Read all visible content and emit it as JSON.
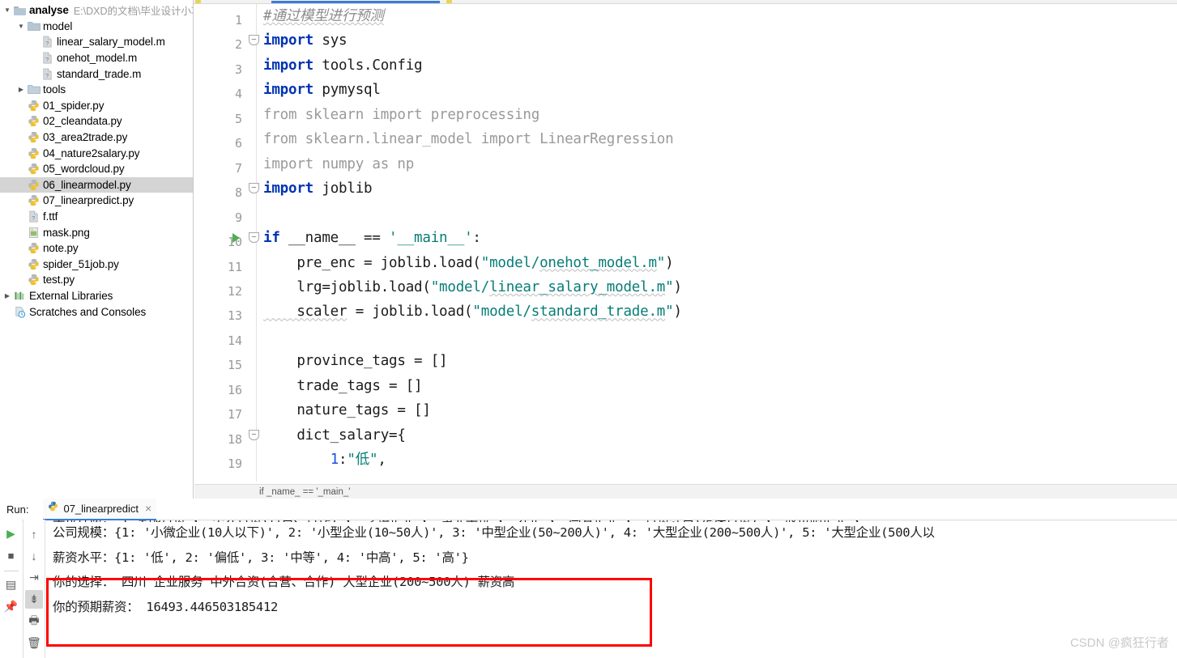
{
  "sidebar": {
    "project": {
      "name": "analyse",
      "path": "E:\\DXD的文档\\毕业设计小项目",
      "twisty": "▼"
    },
    "items": [
      {
        "label": "model",
        "icon": "folder-open-icon",
        "type": "folder",
        "depth": 1,
        "twisty": "▼",
        "selected": false
      },
      {
        "label": "linear_salary_model.m",
        "icon": "unknown-file-icon",
        "type": "file",
        "depth": 2,
        "twisty": "",
        "selected": false
      },
      {
        "label": "onehot_model.m",
        "icon": "unknown-file-icon",
        "type": "file",
        "depth": 2,
        "twisty": "",
        "selected": false
      },
      {
        "label": "standard_trade.m",
        "icon": "unknown-file-icon",
        "type": "file",
        "depth": 2,
        "twisty": "",
        "selected": false
      },
      {
        "label": "tools",
        "icon": "folder-closed-icon",
        "type": "folder",
        "depth": 1,
        "twisty": "▶",
        "selected": false
      },
      {
        "label": "01_spider.py",
        "icon": "python-file-icon",
        "type": "file",
        "depth": 1,
        "twisty": "",
        "selected": false
      },
      {
        "label": "02_cleandata.py",
        "icon": "python-file-icon",
        "type": "file",
        "depth": 1,
        "twisty": "",
        "selected": false
      },
      {
        "label": "03_area2trade.py",
        "icon": "python-file-icon",
        "type": "file",
        "depth": 1,
        "twisty": "",
        "selected": false
      },
      {
        "label": "04_nature2salary.py",
        "icon": "python-file-icon",
        "type": "file",
        "depth": 1,
        "twisty": "",
        "selected": false
      },
      {
        "label": "05_wordcloud.py",
        "icon": "python-file-icon",
        "type": "file",
        "depth": 1,
        "twisty": "",
        "selected": false
      },
      {
        "label": "06_linearmodel.py",
        "icon": "python-file-icon",
        "type": "file",
        "depth": 1,
        "twisty": "",
        "selected": true
      },
      {
        "label": "07_linearpredict.py",
        "icon": "python-file-icon",
        "type": "file",
        "depth": 1,
        "twisty": "",
        "selected": false
      },
      {
        "label": "f.ttf",
        "icon": "unknown-file-icon",
        "type": "file",
        "depth": 1,
        "twisty": "",
        "selected": false
      },
      {
        "label": "mask.png",
        "icon": "image-file-icon",
        "type": "file",
        "depth": 1,
        "twisty": "",
        "selected": false
      },
      {
        "label": "note.py",
        "icon": "python-file-icon",
        "type": "file",
        "depth": 1,
        "twisty": "",
        "selected": false
      },
      {
        "label": "spider_51job.py",
        "icon": "python-file-icon",
        "type": "file",
        "depth": 1,
        "twisty": "",
        "selected": false
      },
      {
        "label": "test.py",
        "icon": "python-file-icon",
        "type": "file",
        "depth": 1,
        "twisty": "",
        "selected": false
      },
      {
        "label": "External Libraries",
        "icon": "libraries-icon",
        "type": "node",
        "depth": 0,
        "twisty": "▶",
        "selected": false
      },
      {
        "label": "Scratches and Consoles",
        "icon": "scratches-icon",
        "type": "node",
        "depth": 0,
        "twisty": "",
        "selected": false
      }
    ]
  },
  "editor": {
    "breadcrumb": "if _name_ == '_main_'",
    "lines": [
      {
        "n": "1",
        "fold": "",
        "run": false,
        "tokens": [
          {
            "t": "#通过模型进行预测",
            "c": "cmt squig"
          }
        ]
      },
      {
        "n": "2",
        "fold": "pointed",
        "run": false,
        "tokens": [
          {
            "t": "import ",
            "c": "kw"
          },
          {
            "t": "sys",
            "c": "ident"
          }
        ]
      },
      {
        "n": "3",
        "fold": "",
        "run": false,
        "tokens": [
          {
            "t": "import ",
            "c": "kw"
          },
          {
            "t": "tools.Config",
            "c": "ident"
          }
        ]
      },
      {
        "n": "4",
        "fold": "",
        "run": false,
        "tokens": [
          {
            "t": "import ",
            "c": "kw"
          },
          {
            "t": "pymysql",
            "c": "ident"
          }
        ]
      },
      {
        "n": "5",
        "fold": "",
        "run": false,
        "tokens": [
          {
            "t": "from sklearn import preprocessing",
            "c": "dim"
          }
        ]
      },
      {
        "n": "6",
        "fold": "",
        "run": false,
        "tokens": [
          {
            "t": "from sklearn.linear_model import LinearRegression",
            "c": "dim"
          }
        ]
      },
      {
        "n": "7",
        "fold": "",
        "run": false,
        "tokens": [
          {
            "t": "import numpy as np",
            "c": "dim"
          }
        ]
      },
      {
        "n": "8",
        "fold": "pointed",
        "run": false,
        "tokens": [
          {
            "t": "import ",
            "c": "kw"
          },
          {
            "t": "joblib",
            "c": "ident"
          }
        ]
      },
      {
        "n": "9",
        "fold": "",
        "run": false,
        "tokens": []
      },
      {
        "n": "10",
        "fold": "pointed",
        "run": true,
        "tokens": [
          {
            "t": "if",
            "c": "kw"
          },
          {
            "t": " __name__ == ",
            "c": "ident"
          },
          {
            "t": "'__main__'",
            "c": "str"
          },
          {
            "t": ":",
            "c": "ident"
          }
        ]
      },
      {
        "n": "11",
        "fold": "",
        "run": false,
        "tokens": [
          {
            "t": "    pre_enc = joblib.load(",
            "c": "ident"
          },
          {
            "t": "\"model/",
            "c": "str"
          },
          {
            "t": "onehot_model.m",
            "c": "str squig"
          },
          {
            "t": "\"",
            "c": "str"
          },
          {
            "t": ")",
            "c": "ident"
          }
        ]
      },
      {
        "n": "12",
        "fold": "",
        "run": false,
        "tokens": [
          {
            "t": "    lrg=joblib.load(",
            "c": "ident"
          },
          {
            "t": "\"model/",
            "c": "str"
          },
          {
            "t": "linear_salary_model.m",
            "c": "str squig"
          },
          {
            "t": "\"",
            "c": "str"
          },
          {
            "t": ")",
            "c": "ident"
          }
        ]
      },
      {
        "n": "13",
        "fold": "",
        "run": false,
        "tokens": [
          {
            "t": "    scaler",
            "c": "ident squig"
          },
          {
            "t": " = joblib.load(",
            "c": "ident"
          },
          {
            "t": "\"model/",
            "c": "str"
          },
          {
            "t": "standard_trade.m",
            "c": "str squig"
          },
          {
            "t": "\"",
            "c": "str"
          },
          {
            "t": ")",
            "c": "ident"
          }
        ]
      },
      {
        "n": "14",
        "fold": "",
        "run": false,
        "tokens": []
      },
      {
        "n": "15",
        "fold": "",
        "run": false,
        "tokens": [
          {
            "t": "    province_tags = []",
            "c": "ident"
          }
        ]
      },
      {
        "n": "16",
        "fold": "",
        "run": false,
        "tokens": [
          {
            "t": "    trade_tags = []",
            "c": "ident"
          }
        ]
      },
      {
        "n": "17",
        "fold": "",
        "run": false,
        "tokens": [
          {
            "t": "    nature_tags = []",
            "c": "ident"
          }
        ]
      },
      {
        "n": "18",
        "fold": "pointed",
        "run": false,
        "tokens": [
          {
            "t": "    dict_salary={",
            "c": "ident"
          }
        ]
      },
      {
        "n": "19",
        "fold": "",
        "run": false,
        "tokens": [
          {
            "t": "        ",
            "c": "ident"
          },
          {
            "t": "1",
            "c": "num"
          },
          {
            "t": ":",
            "c": "ident"
          },
          {
            "t": "\"低\"",
            "c": "str"
          },
          {
            "t": ",",
            "c": "ident"
          }
        ]
      }
    ]
  },
  "run_panel": {
    "label": "Run:",
    "tab_name": "07_linearpredict",
    "tab_close": "×",
    "left_tools": [
      {
        "name": "rerun-button",
        "glyph": "▶"
      },
      {
        "name": "stop-button",
        "glyph": "■"
      },
      {
        "name": "layout-button",
        "glyph": "▤"
      },
      {
        "name": "pin-button",
        "glyph": "📌"
      }
    ],
    "right_tools": [
      {
        "name": "scroll-up-button",
        "glyph": "↑",
        "active": false
      },
      {
        "name": "scroll-down-button",
        "glyph": "↓",
        "active": false
      },
      {
        "name": "soft-wrap-button",
        "glyph": "⇥",
        "active": false
      },
      {
        "name": "scroll-to-end-button",
        "glyph": "⇟",
        "active": true
      },
      {
        "name": "print-button",
        "glyph": "🖶",
        "active": false
      },
      {
        "name": "clear-all-button",
        "glyph": "🗑",
        "active": false
      }
    ],
    "console_lines": [
      {
        "text": "单位性质： {'全部合资'，'中外合资(合营、合作)'，'乡镇企业'，'事业单位'，'外企'，'国有企业'，'合资经营(港澳台资)'，'股份制企业'，'",
        "clipped": true
      },
      {
        "text": "公司规模：{1: '小微企业(10人以下)', 2: '小型企业(10~50人)', 3: '中型企业(50~200人)', 4: '大型企业(200~500人)', 5: '大型企业(500人以",
        "clipped": false
      },
      {
        "text": "薪资水平：{1: '低', 2: '偏低', 3: '中等', 4: '中高', 5: '高'}",
        "clipped": false
      },
      {
        "text": "你的选择： 四川 企业服务 中外合资(合营、合作) 大型企业(200~500人) 薪资高",
        "clipped": false
      },
      {
        "text": "你的预期薪资： 16493.446503185412",
        "clipped": false
      }
    ],
    "highlight_color": "#ff0000"
  },
  "watermark": "CSDN @疯狂行者"
}
